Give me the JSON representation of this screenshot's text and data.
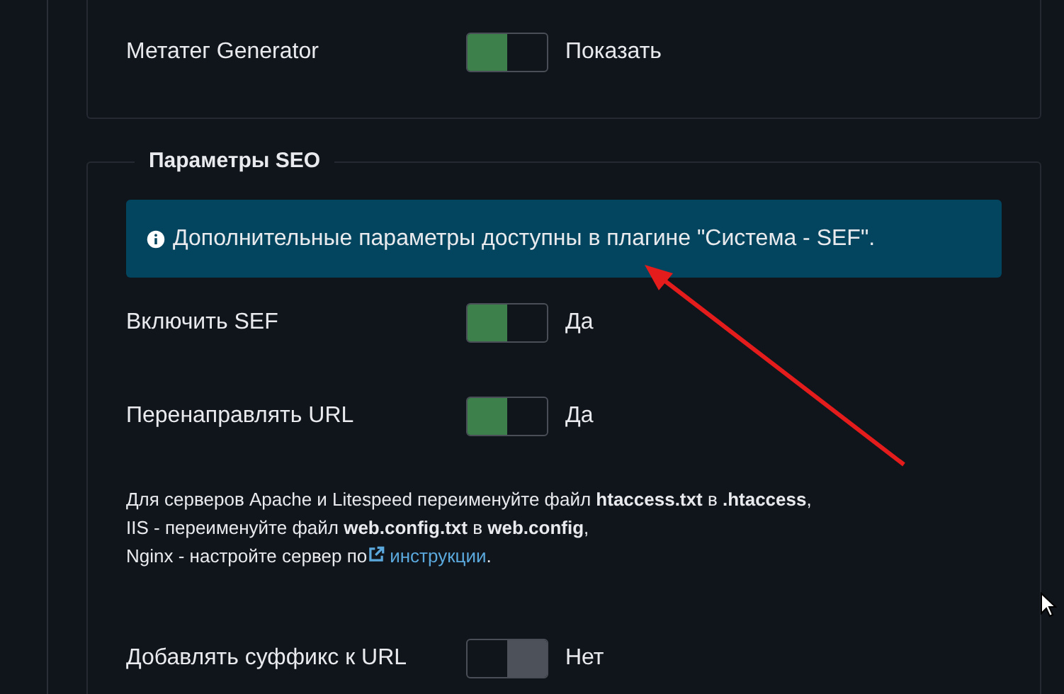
{
  "sections": [
    {
      "rows": [
        {
          "label": "Метатег Generator",
          "on": true,
          "value": "Показать"
        }
      ]
    },
    {
      "legend": "Параметры SEO",
      "alert": "Дополнительные параметры доступны в плагине \"Система - SEF\".",
      "rows": [
        {
          "label": "Включить SEF",
          "on": true,
          "value": "Да"
        },
        {
          "label": "Перенаправлять URL",
          "on": true,
          "value": "Да"
        }
      ],
      "help": {
        "lines": [
          "Для серверов Apache и Litespeed переименуйте файл **htaccess.txt** в **.htaccess**,",
          "IIS - переименуйте файл **web.config.txt** в **web.config**,"
        ],
        "last_prefix": "Nginx - настройте сервер по",
        "link": "инструкции",
        "last_suffix": "."
      },
      "rows_after": [
        {
          "label": "Добавлять суффикс к URL",
          "on": false,
          "value": "Нет"
        }
      ]
    }
  ]
}
